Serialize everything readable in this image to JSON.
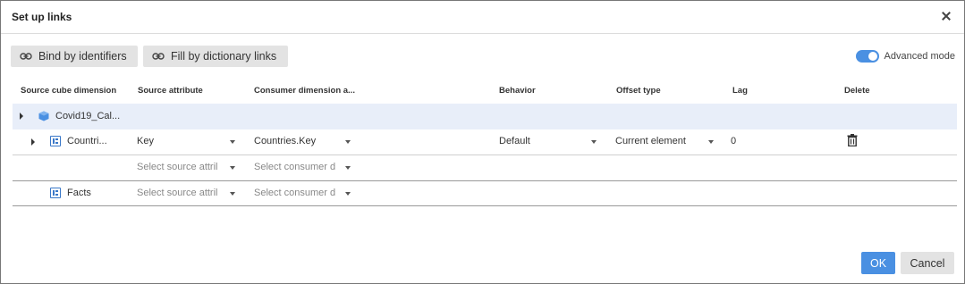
{
  "dialog": {
    "title": "Set up links"
  },
  "toolbar": {
    "bind_label": "Bind by identifiers",
    "fill_label": "Fill by dictionary links",
    "advanced_label": "Advanced mode",
    "advanced_on": true
  },
  "columns": {
    "source_dim": "Source cube dimension",
    "source_attr": "Source attribute",
    "consumer_dim": "Consumer dimension a...",
    "behavior": "Behavior",
    "offset": "Offset type",
    "lag": "Lag",
    "delete": "Delete"
  },
  "rows": {
    "cube": {
      "name": "Covid19_Cal..."
    },
    "countries": {
      "name": "Countri...",
      "source_attr": "Key",
      "consumer": "Countries.Key",
      "behavior": "Default",
      "offset": "Current element",
      "lag": "0"
    },
    "countries_extra": {
      "source_placeholder": "Select source attril",
      "consumer_placeholder": "Select consumer d"
    },
    "facts": {
      "name": "Facts",
      "source_placeholder": "Select source attril",
      "consumer_placeholder": "Select consumer d"
    }
  },
  "footer": {
    "ok_label": "OK",
    "cancel_label": "Cancel"
  },
  "colors": {
    "accent": "#4a90e2",
    "group_row_bg": "#e8eef9"
  }
}
